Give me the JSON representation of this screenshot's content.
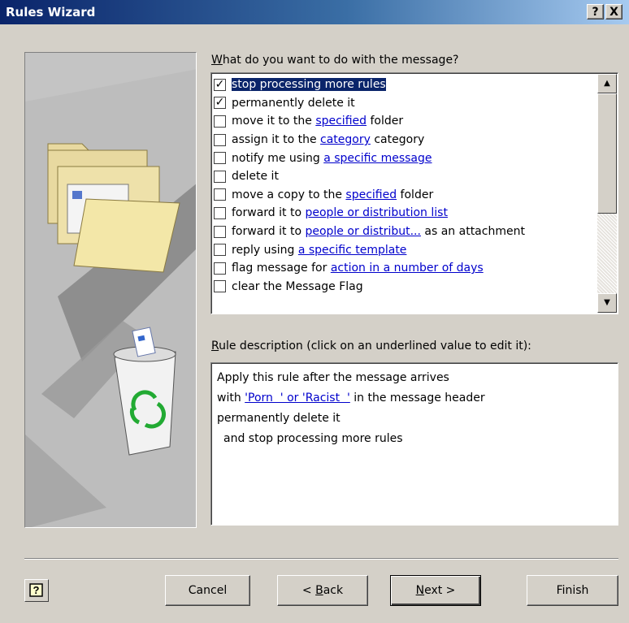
{
  "window": {
    "title": "Rules Wizard",
    "help_button": "?",
    "close_button": "X"
  },
  "actions": {
    "heading_prefix": "W",
    "heading_rest": "hat do you want to do with the message?",
    "items": [
      {
        "checked": true,
        "selected": true,
        "checkmark": "✓",
        "before": "stop processing more rules",
        "link": "",
        "after": ""
      },
      {
        "checked": true,
        "selected": false,
        "checkmark": "✓",
        "before": "permanently delete it",
        "link": "",
        "after": ""
      },
      {
        "checked": false,
        "selected": false,
        "checkmark": "",
        "before": "move it to the ",
        "link": "specified",
        "after": " folder"
      },
      {
        "checked": false,
        "selected": false,
        "checkmark": "",
        "before": "assign it to the ",
        "link": "category",
        "after": " category"
      },
      {
        "checked": false,
        "selected": false,
        "checkmark": "",
        "before": "notify me using ",
        "link": "a specific message",
        "after": ""
      },
      {
        "checked": false,
        "selected": false,
        "checkmark": "",
        "before": "delete it",
        "link": "",
        "after": ""
      },
      {
        "checked": false,
        "selected": false,
        "checkmark": "",
        "before": "move a copy to the ",
        "link": "specified",
        "after": " folder"
      },
      {
        "checked": false,
        "selected": false,
        "checkmark": "",
        "before": "forward it to ",
        "link": "people or distribution list",
        "after": ""
      },
      {
        "checked": false,
        "selected": false,
        "checkmark": "",
        "before": "forward it to ",
        "link": "people or distribut...",
        "after": " as an attachment"
      },
      {
        "checked": false,
        "selected": false,
        "checkmark": "",
        "before": "reply using ",
        "link": "a specific template",
        "after": ""
      },
      {
        "checked": false,
        "selected": false,
        "checkmark": "",
        "before": "flag message for ",
        "link": "action in a number of days",
        "after": ""
      },
      {
        "checked": false,
        "selected": false,
        "checkmark": "",
        "before": "clear the Message Flag",
        "link": "",
        "after": ""
      }
    ]
  },
  "description": {
    "heading_prefix": "R",
    "heading_rest": "ule description (click on an underlined value to edit it):",
    "line1": "Apply this rule after the message arrives",
    "line2_before": "with ",
    "line2_link": "'Porn  ' or 'Racist  '",
    "line2_after": " in the message header",
    "line3": "permanently delete it",
    "line4": "and stop processing more rules"
  },
  "buttons": {
    "help": "?",
    "cancel": "Cancel",
    "back_prefix": "< ",
    "back_key": "B",
    "back_rest": "ack",
    "next_key": "N",
    "next_rest": "ext >",
    "finish": "Finish"
  },
  "scrollbar": {
    "up": "▲",
    "down": "▼"
  }
}
